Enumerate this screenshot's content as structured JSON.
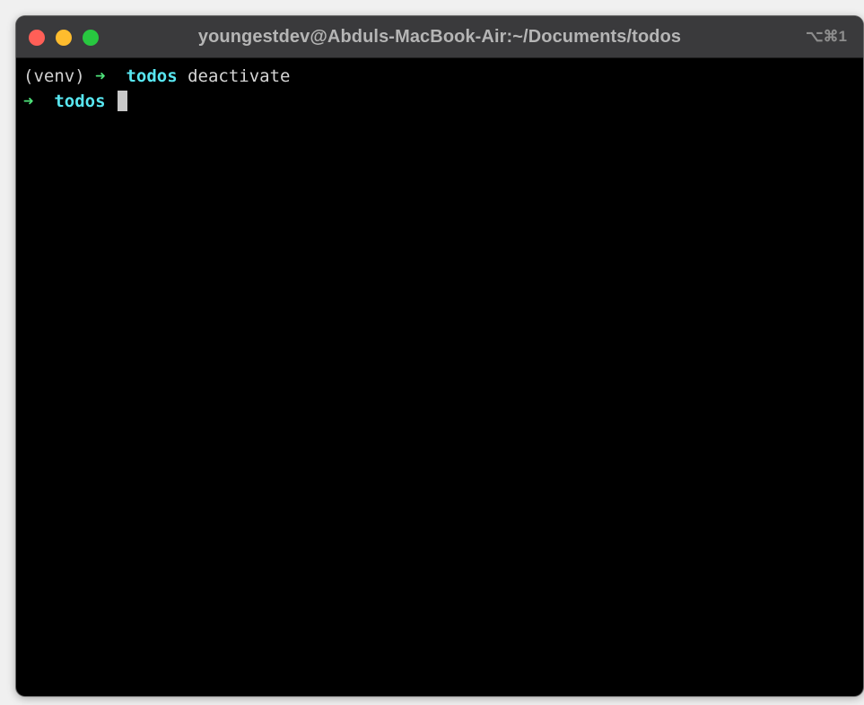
{
  "window": {
    "title": "youngestdev@Abduls-MacBook-Air:~/Documents/todos",
    "shortcut": "⌥⌘1"
  },
  "terminal": {
    "lines": [
      {
        "venv": "(venv)",
        "arrow": "➜",
        "dir": "todos",
        "command": "deactivate"
      },
      {
        "arrow": "➜",
        "dir": "todos"
      }
    ]
  },
  "colors": {
    "background": "#000000",
    "titlebar": "#3a3a3c",
    "arrow": "#4ee37a",
    "directory": "#58e6f0",
    "text": "#d0d0d0"
  }
}
